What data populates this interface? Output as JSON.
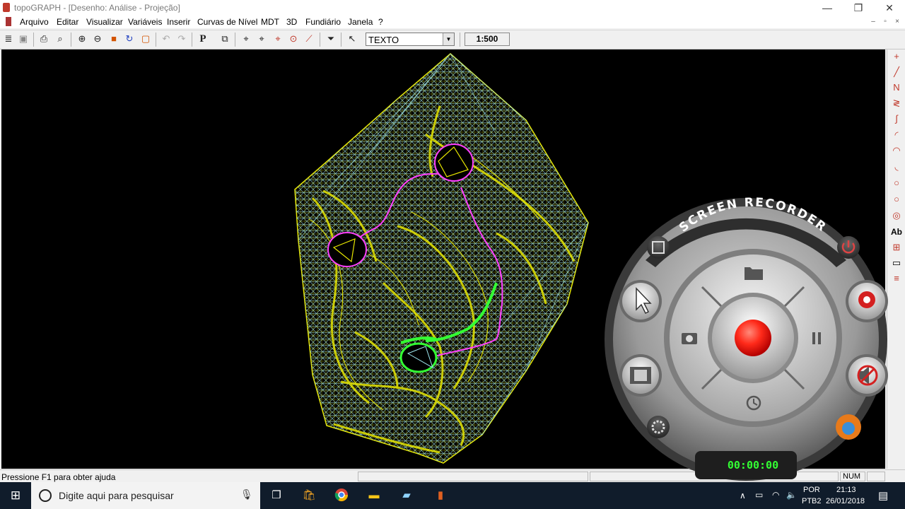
{
  "window": {
    "title": "topoGRAPH - [Desenho: Análise - Projeção]",
    "min_glyph": "—",
    "max_glyph": "❐",
    "close_glyph": "✕"
  },
  "menu": {
    "items": [
      "Arquivo",
      "Editar",
      "Visualizar",
      "Variáveis",
      "Inserir",
      "Curvas de Nível",
      "MDT",
      "3D",
      "Fundiário",
      "Janela",
      "?"
    ],
    "mdi_min": "–",
    "mdi_restore": "▫",
    "mdi_close": "×"
  },
  "toolbar": {
    "text_style_value": "TEXTO",
    "scale_value": "1:500",
    "p_button_label": "P"
  },
  "right_tools": {
    "text_tool_label": "Ab"
  },
  "statusbar": {
    "help_text": "Pressione F1 para obter ajuda",
    "num_indicator": "NUM"
  },
  "recorder": {
    "title": "SCREEN RECORDER",
    "timer": "00:00:00",
    "accent_color": "#ff2a1a"
  },
  "taskbar": {
    "search_placeholder": "Digite aqui para pesquisar",
    "language_top": "POR",
    "language_bottom": "PTB2",
    "time": "21:13",
    "date": "26/01/2018"
  },
  "colors": {
    "canvas_bg": "#000000",
    "mesh_yellow": "#e6e600",
    "mesh_cyan": "#9fe8f0",
    "path_magenta": "#ff40ff",
    "highlight_green": "#33ff33",
    "taskbar_bg": "#101c2b"
  }
}
